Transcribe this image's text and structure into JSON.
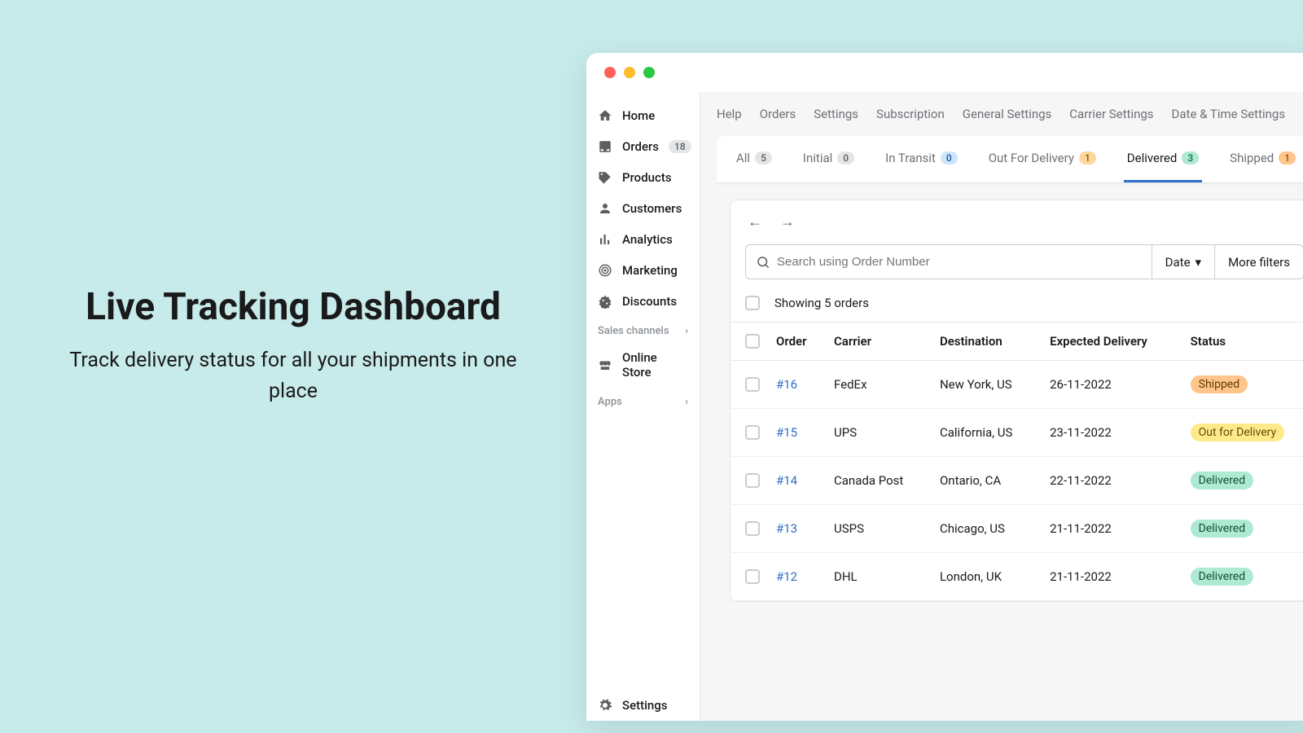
{
  "hero": {
    "title": "Live Tracking Dashboard",
    "subtitle": "Track delivery status for all your shipments in one place"
  },
  "sidebar": {
    "items": [
      {
        "label": "Home"
      },
      {
        "label": "Orders",
        "badge": "18"
      },
      {
        "label": "Products"
      },
      {
        "label": "Customers"
      },
      {
        "label": "Analytics"
      },
      {
        "label": "Marketing"
      },
      {
        "label": "Discounts"
      }
    ],
    "salesChannels": "Sales channels",
    "onlineStore": "Online Store",
    "apps": "Apps",
    "settings": "Settings"
  },
  "topnav": [
    "Help",
    "Orders",
    "Settings",
    "Subscription",
    "General Settings",
    "Carrier Settings",
    "Date & Time Settings"
  ],
  "tabs": [
    {
      "label": "All",
      "count": "5",
      "pill": "gray"
    },
    {
      "label": "Initial",
      "count": "0",
      "pill": "gray"
    },
    {
      "label": "In Transit",
      "count": "0",
      "pill": "blue"
    },
    {
      "label": "Out For Delivery",
      "count": "1",
      "pill": "yellow"
    },
    {
      "label": "Delivered",
      "count": "3",
      "pill": "green",
      "active": true
    },
    {
      "label": "Shipped",
      "count": "1",
      "pill": "orange"
    }
  ],
  "search": {
    "placeholder": "Search using Order Number"
  },
  "dateBtn": "Date",
  "filtersBtn": "More filters",
  "showing": "Showing 5 orders",
  "columns": [
    "Order",
    "Carrier",
    "Destination",
    "Expected Delivery",
    "Status"
  ],
  "rows": [
    {
      "order": "#16",
      "carrier": "FedEx",
      "dest": "New York, US",
      "eta": "26-11-2022",
      "status": "Shipped",
      "statusClass": "sb-shipped"
    },
    {
      "order": "#15",
      "carrier": "UPS",
      "dest": "California, US",
      "eta": "23-11-2022",
      "status": "Out for Delivery",
      "statusClass": "sb-out"
    },
    {
      "order": "#14",
      "carrier": "Canada Post",
      "dest": "Ontario, CA",
      "eta": "22-11-2022",
      "status": "Delivered",
      "statusClass": "sb-delivered"
    },
    {
      "order": "#13",
      "carrier": "USPS",
      "dest": "Chicago, US",
      "eta": "21-11-2022",
      "status": "Delivered",
      "statusClass": "sb-delivered"
    },
    {
      "order": "#12",
      "carrier": "DHL",
      "dest": "London, UK",
      "eta": "21-11-2022",
      "status": "Delivered",
      "statusClass": "sb-delivered"
    }
  ]
}
